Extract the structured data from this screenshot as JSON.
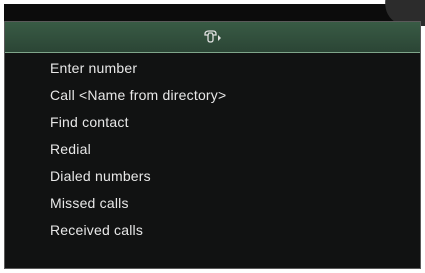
{
  "colors": {
    "header_background": "#395b45",
    "header_border": "#7fa58a",
    "screen_background": "#111212",
    "text": "#e8e8e8"
  },
  "header": {
    "icon": "phone-handset-icon"
  },
  "menu": {
    "items": [
      {
        "label": "Enter number"
      },
      {
        "label": "Call <Name from directory>"
      },
      {
        "label": "Find contact"
      },
      {
        "label": "Redial"
      },
      {
        "label": "Dialed numbers"
      },
      {
        "label": "Missed calls"
      },
      {
        "label": "Received calls"
      }
    ]
  }
}
